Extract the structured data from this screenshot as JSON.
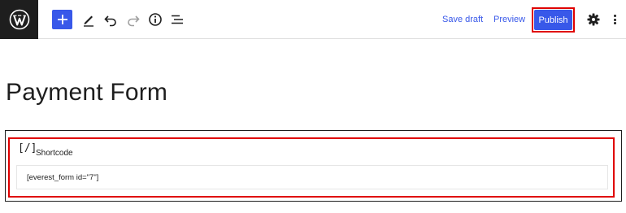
{
  "topbar": {
    "logo_icon": "wordpress-logo-icon",
    "tools": [
      "add-block-icon",
      "edit-pencil-icon",
      "undo-icon",
      "redo-icon",
      "info-icon",
      "list-view-icon"
    ],
    "save_draft_label": "Save draft",
    "preview_label": "Preview",
    "publish_label": "Publish",
    "settings_icon": "gear-icon",
    "options_icon": "kebab-menu-icon"
  },
  "colors": {
    "accent": "#3858e9",
    "highlight": "#e00000",
    "logo_bg": "#1e1e1e"
  },
  "post": {
    "title": "Payment Form",
    "block": {
      "icon_text": "[/]",
      "label": "Shortcode",
      "value": "[everest_form id=\"7\"]"
    }
  }
}
